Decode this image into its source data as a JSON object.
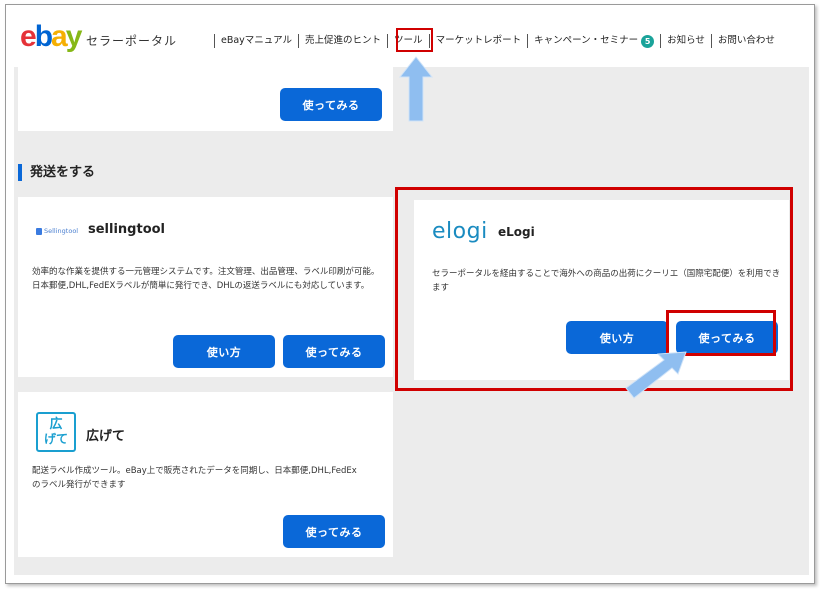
{
  "brand": {
    "logo": "ebay",
    "subtitle": "セラーポータル"
  },
  "nav": [
    {
      "label": "eBayマニュアル"
    },
    {
      "label": "売上促進のヒント"
    },
    {
      "label": "ツール"
    },
    {
      "label": "マーケットレポート"
    },
    {
      "label": "キャンペーン・セミナー",
      "badge": "5"
    },
    {
      "label": "お知らせ"
    },
    {
      "label": "お問い合わせ"
    }
  ],
  "top_card": {
    "try_label": "使ってみる"
  },
  "section": {
    "title": "発送をする"
  },
  "sellingtool": {
    "logo_text": "Sellingtool",
    "title": "sellingtool",
    "description": "効率的な作業を提供する一元管理システムです。注文管理、出品管理、ラベル印刷が可能。日本郵便,DHL,FedEXラベルが簡単に発行でき、DHLの返送ラベルにも対応しています。",
    "howto_label": "使い方",
    "try_label": "使ってみる"
  },
  "elogi": {
    "logo_text": "elogi",
    "title": "eLogi",
    "description": "セラーポータルを経由することで海外への商品の出荷にクーリエ（国際宅配便）を利用できます",
    "howto_label": "使い方",
    "try_label": "使ってみる"
  },
  "hirogete": {
    "logo_text_1": "広",
    "logo_text_2": "げて",
    "title": "広げて",
    "description": "配送ラベル作成ツール。eBay上で販売されたデータを同期し、日本郵便,DHL,FedExのラベル発行ができます",
    "try_label": "使ってみる"
  },
  "colors": {
    "accent": "#0a68d8",
    "highlight": "#d00000",
    "arrow": "#8fbef0"
  }
}
